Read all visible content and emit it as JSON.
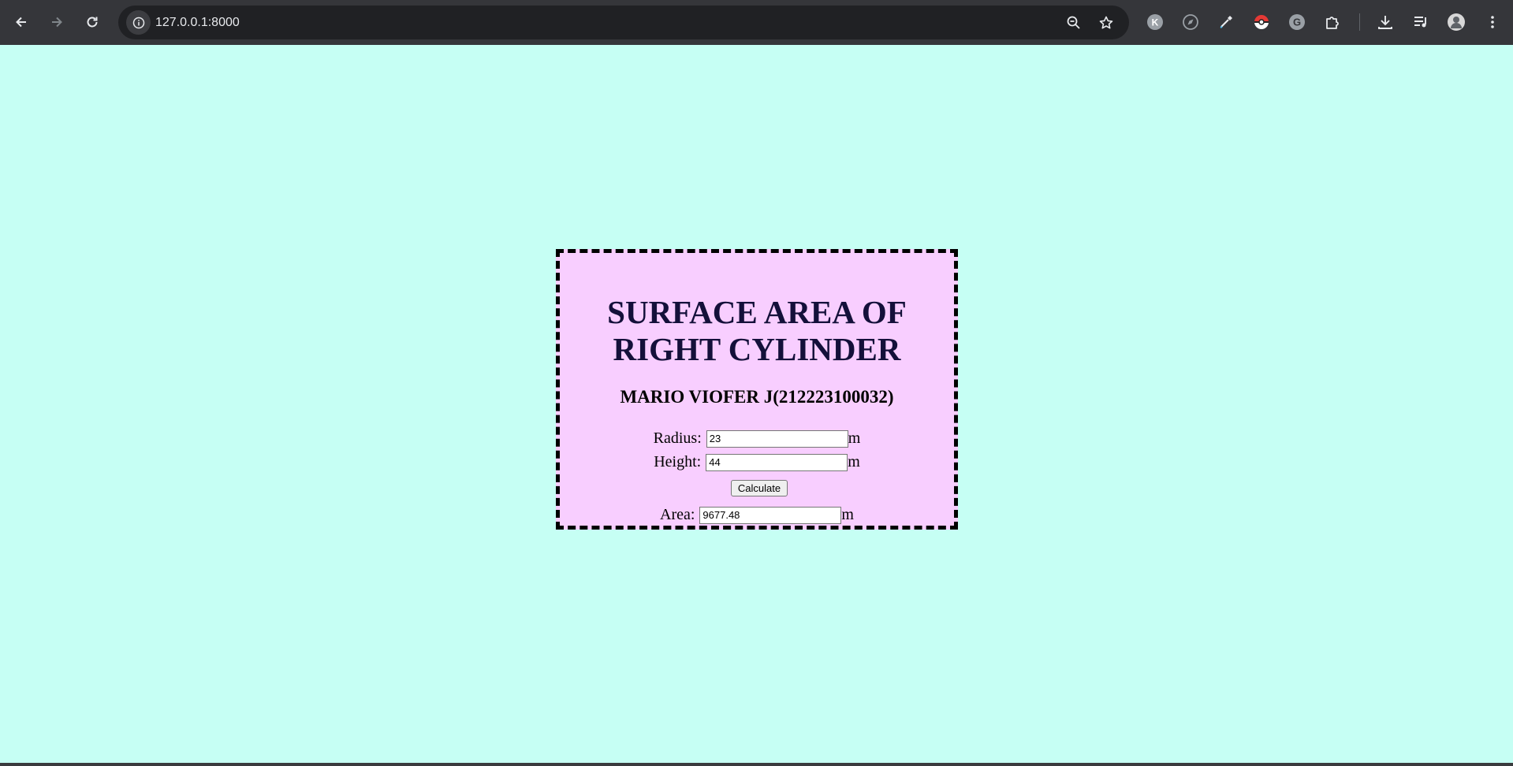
{
  "browser": {
    "url": "127.0.0.1:8000",
    "icons": {
      "back": "arrow-left-icon",
      "forward": "arrow-right-icon",
      "reload": "reload-icon",
      "site_info": "info-icon",
      "zoom": "zoom-out-icon",
      "bookmark": "star-icon",
      "extensions": [
        "k-extension-icon",
        "compass-extension-icon",
        "eyedropper-extension-icon",
        "pokeball-extension-icon",
        "grammarly-extension-icon",
        "puzzle-extension-icon"
      ],
      "download": "download-icon",
      "media": "media-queue-icon",
      "profile": "avatar",
      "menu": "kebab-menu-icon"
    }
  },
  "page": {
    "background": "#c6fff4",
    "card_background": "#f8ceff",
    "title_line1": "SURFACE AREA OF",
    "title_line2": "RIGHT CYLINDER",
    "subtitle": "MARIO VIOFER J(212223100032)",
    "radius_label": "Radius:",
    "radius_value": "23",
    "radius_unit": "m",
    "height_label": "Height:",
    "height_value": "44",
    "height_unit": "m",
    "calculate_label": "Calculate",
    "area_label": "Area:",
    "area_value": "9677.48",
    "area_unit": "m"
  }
}
